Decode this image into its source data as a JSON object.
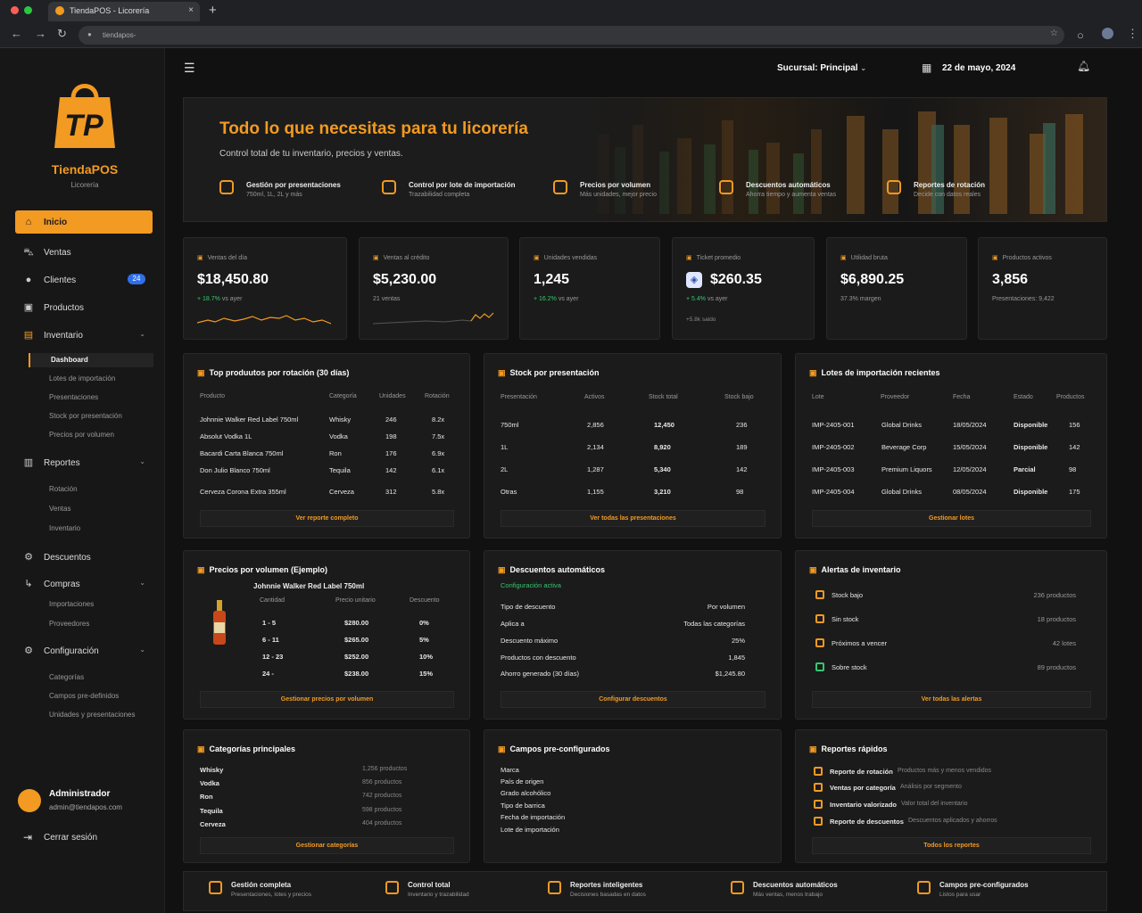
{
  "browser": {
    "tab_title": "TiendaPOS - Licorería",
    "url": "tiendapos-"
  },
  "app": {
    "name": "TiendaPOS",
    "subtitle": "Licorería",
    "colors": {
      "accent": "#f29a22",
      "blue": "#2f6fe8",
      "green": "#35c76e"
    }
  },
  "nav": [
    {
      "label": "Inicio",
      "icon": "home-icon",
      "active": true
    },
    {
      "label": "Ventas",
      "icon": "cart-icon"
    },
    {
      "label": "Clientes",
      "icon": "user-icon",
      "badge": "24"
    },
    {
      "label": "Productos",
      "icon": "box-icon"
    },
    {
      "label": "Inventario",
      "icon": "inventory-icon"
    },
    {
      "label": "Reportes",
      "icon": "report-icon"
    },
    {
      "label": "Descuentos",
      "icon": "discount-icon"
    },
    {
      "label": "Compras",
      "icon": "purchase-icon"
    },
    {
      "label": "Configuración",
      "icon": "gear-icon"
    }
  ],
  "subnav": {
    "inventario": [
      "Dashboard",
      "Lotes de importación",
      "Presentaciones",
      "Stock por presentación",
      "Precios por volumen"
    ],
    "reportes": [
      "Rotación",
      "Ventas",
      "Inventario"
    ],
    "compras": [
      "Importaciones",
      "Proveedores"
    ],
    "configuracion": [
      "Categorías",
      "Campos pre-definidos",
      "Unidades y presentaciones"
    ]
  },
  "user": {
    "name": "Administrador",
    "email": "admin@tiendapos.com",
    "logout": "Cerrar sesión"
  },
  "topbar": {
    "branch": "Sucursal: Principal",
    "date": "22 de mayo, 2024"
  },
  "hero": {
    "title": "Todo lo que necesitas para tu licorería",
    "subtitle": "Control total de tu inventario, precios y ventas.",
    "features": [
      {
        "t": "Gestión por presentaciones",
        "s": "750ml, 1L, 2L y más"
      },
      {
        "t": "Control por lote de importación",
        "s": "Trazabilidad completa"
      },
      {
        "t": "Precios por volumen",
        "s": "Más unidades, mejor precio"
      },
      {
        "t": "Descuentos automáticos",
        "s": "Ahorra tiempo y aumenta ventas"
      },
      {
        "t": "Reportes de rotación",
        "s": "Decide con datos reales"
      }
    ]
  },
  "kpis": [
    {
      "label": "Ventas del día",
      "value": "$18,450.80",
      "delta": "+ 18.7%",
      "note": "vs ayer"
    },
    {
      "label": "Ventas al crédito",
      "value": "$5,230.00",
      "note": "21 ventas"
    },
    {
      "label": "Unidades vendidas",
      "value": "1,245",
      "delta": "+ 16.2%",
      "note": "vs ayer"
    },
    {
      "label": "Ticket promedio",
      "value": "$260.35",
      "delta": "+ 5.4%",
      "note": "vs ayer",
      "extra": "+5.8k saldo"
    },
    {
      "label": "Utilidad bruta",
      "value": "$6,890.25",
      "note": "37.3% margen"
    },
    {
      "label": "Productos activos",
      "value": "3,856",
      "note": "Presentaciones: 9,422"
    }
  ],
  "top": {
    "title": "Top produutos por rotación (30 días)",
    "cols": [
      "Producto",
      "Categoría",
      "Unidades",
      "Rotación"
    ],
    "rows": [
      [
        "Johnnie Walker Red Label 750ml",
        "Whisky",
        "246",
        "8.2x"
      ],
      [
        "Absolut Vodka 1L",
        "Vodka",
        "198",
        "7.5x"
      ],
      [
        "Bacardi Carta Blanca 750ml",
        "Ron",
        "176",
        "6.9x"
      ],
      [
        "Don Julio Blanco 750ml",
        "Tequila",
        "142",
        "6.1x"
      ],
      [
        "Cerveza Corona Extra 355ml",
        "Cerveza",
        "312",
        "5.8x"
      ]
    ],
    "button": "Ver reporte completo"
  },
  "stock": {
    "title": "Stock por presentación",
    "cols": [
      "Presentación",
      "Activos",
      "Stock total",
      "Stock bajo"
    ],
    "rows": [
      [
        "750ml",
        "2,856",
        "12,450",
        "236"
      ],
      [
        "1L",
        "2,134",
        "8,920",
        "189"
      ],
      [
        "2L",
        "1,287",
        "5,340",
        "142"
      ],
      [
        "Otras",
        "1,155",
        "3,210",
        "98"
      ]
    ],
    "button": "Ver todas las presentaciones"
  },
  "lotes": {
    "title": "Lotes de importación recientes",
    "cols": [
      "Lote",
      "Proveedor",
      "Fecha",
      "Estado",
      "Productos"
    ],
    "rows": [
      [
        "IMP-2405-001",
        "Global Drinks",
        "18/05/2024",
        "Disponible",
        "156"
      ],
      [
        "IMP-2405-002",
        "Beverage Corp",
        "15/05/2024",
        "Disponible",
        "142"
      ],
      [
        "IMP-2405-003",
        "Premium Liquors",
        "12/05/2024",
        "Parcial",
        "98"
      ],
      [
        "IMP-2405-004",
        "Global Drinks",
        "08/05/2024",
        "Disponible",
        "175"
      ]
    ],
    "button": "Gestionar lotes"
  },
  "precios": {
    "title": "Precios por volumen (Ejemplo)",
    "product": "Johnnie Walker Red Label 750ml",
    "cols": [
      "Cantidad",
      "Precio unitario",
      "Descuento"
    ],
    "rows": [
      [
        "1 - 5",
        "$280.00",
        "0%"
      ],
      [
        "6 - 11",
        "$265.00",
        "5%"
      ],
      [
        "12 - 23",
        "$252.00",
        "10%"
      ],
      [
        "24 -",
        "$238.00",
        "15%"
      ]
    ],
    "button": "Gestionar precios por volumen"
  },
  "desc": {
    "title": "Descuentos automáticos",
    "status": "Configuración activa",
    "rows": [
      [
        "Tipo de descuento",
        "Por volumen"
      ],
      [
        "Aplica a",
        "Todas las categorías"
      ],
      [
        "Descuento máximo",
        "25%"
      ],
      [
        "Productos con descuento",
        "1,845"
      ],
      [
        "Ahorro generado (30 días)",
        "$1,245.80"
      ]
    ],
    "button": "Configurar descuentos"
  },
  "alertas": {
    "title": "Alertas de inventario",
    "rows": [
      [
        "Stock bajo",
        "236 productos"
      ],
      [
        "Sin stock",
        "18 productos"
      ],
      [
        "Próximos a vencer",
        "42 lotes"
      ],
      [
        "Sobre stock",
        "89 productos"
      ]
    ],
    "button": "Ver todas las alertas"
  },
  "cats": {
    "title": "Categorías principales",
    "rows": [
      [
        "Whisky",
        "1,256 productos"
      ],
      [
        "Vodka",
        "856 productos"
      ],
      [
        "Ron",
        "742 productos"
      ],
      [
        "Tequila",
        "598 productos"
      ],
      [
        "Cerveza",
        "404 productos"
      ]
    ],
    "button": "Gestionar categorías"
  },
  "campos": {
    "title": "Campos pre-configurados",
    "rows": [
      "Marca",
      "País de origen",
      "Grado alcohólico",
      "Tipo de barrica",
      "Fecha de importación",
      "Lote de importación"
    ],
    "button": ""
  },
  "reportes": {
    "title": "Reportes rápidos",
    "rows": [
      [
        "Reporte de rotación",
        "Productos más y menos vendidos"
      ],
      [
        "Ventas por categoría",
        "Análisis por segmento"
      ],
      [
        "Inventario valorizado",
        "Valor total del inventario"
      ],
      [
        "Reporte de descuentos",
        "Descuentos aplicados y ahorros"
      ]
    ],
    "button": "Todos los reportes"
  },
  "footer": [
    {
      "t": "Gestión completa",
      "s": "Presentaciones, lotes y precios"
    },
    {
      "t": "Control total",
      "s": "Inventario y trazabilidad"
    },
    {
      "t": "Reportes inteligentes",
      "s": "Decisiones basadas en datos"
    },
    {
      "t": "Descuentos automáticos",
      "s": "Más ventas, menos trabajo"
    },
    {
      "t": "Campos pre-configurados",
      "s": "Listos para usar"
    }
  ]
}
